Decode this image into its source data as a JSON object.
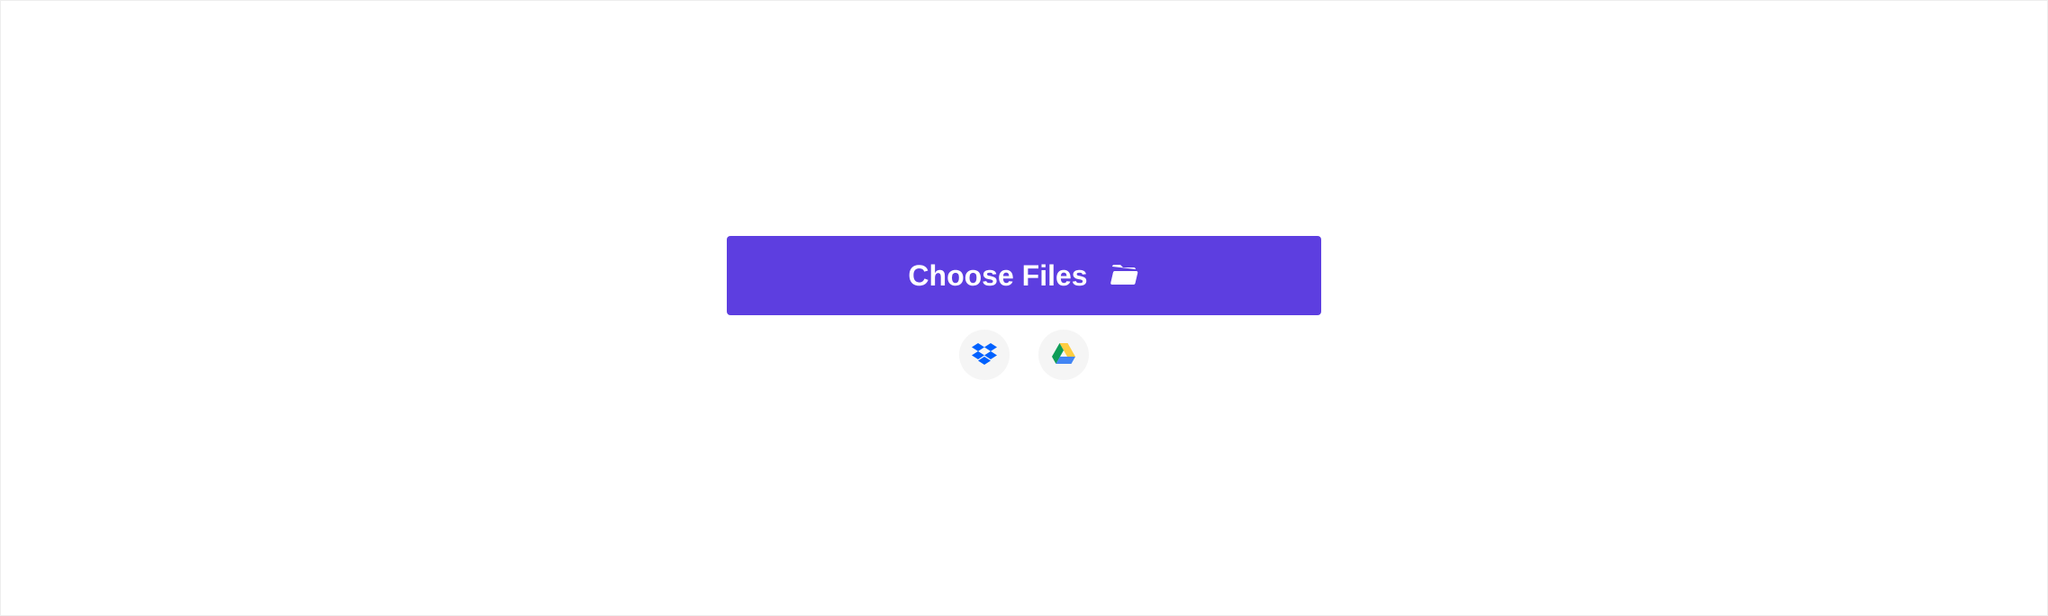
{
  "upload": {
    "choose_files_label": "Choose Files",
    "providers": {
      "dropbox": {
        "name": "Dropbox"
      },
      "google_drive": {
        "name": "Google Drive"
      }
    }
  },
  "colors": {
    "primary": "#5d3ee0",
    "dropbox_blue": "#0061ff",
    "google_green": "#0f9d58",
    "google_yellow": "#ffcd40",
    "google_blue": "#4285f4"
  }
}
